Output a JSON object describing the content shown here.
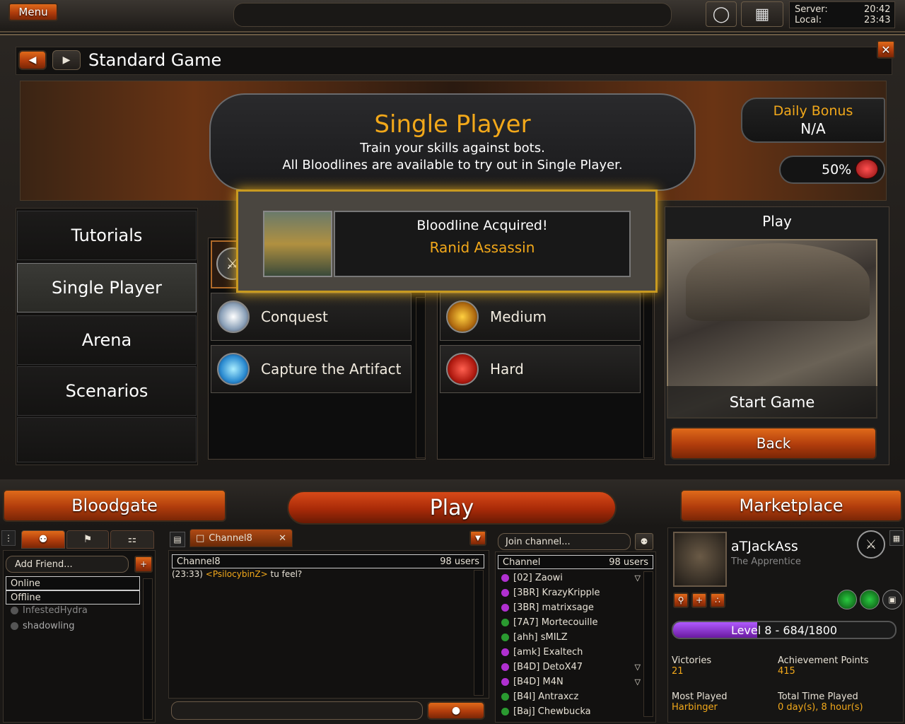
{
  "topbar": {
    "menu_label": "Menu",
    "server_label": "Server:",
    "server_time": "20:42",
    "local_label": "Local:",
    "local_time": "23:43"
  },
  "header": {
    "title": "Standard Game"
  },
  "banner": {
    "title": "Single Player",
    "line1": "Train your skills against bots.",
    "line2": "All Bloodlines are available to try out in Single Player."
  },
  "daily": {
    "label": "Daily Bonus",
    "value": "N/A",
    "percent": "50%"
  },
  "menu": {
    "items": [
      "Tutorials",
      "Single Player",
      "Arena",
      "Scenarios"
    ]
  },
  "notice": {
    "title": "Bloodline Acquired!",
    "name": "Ranid Assassin"
  },
  "modes": [
    "Conquest",
    "Capture the Artifact"
  ],
  "difficulty": [
    "Medium",
    "Hard"
  ],
  "playpanel": {
    "title": "Play",
    "start": "Start Game",
    "back": "Back"
  },
  "nav": {
    "left": "Bloodgate",
    "center": "Play",
    "right": "Marketplace"
  },
  "friends": {
    "add": "Add Friend...",
    "online": "Online",
    "offline": "Offline",
    "names": [
      "InfestedHydra",
      "shadowling"
    ]
  },
  "chat": {
    "tab": "Channel8",
    "header": "Channel8",
    "users": "98 users",
    "message_time": "(23:33)",
    "message_user": "<PsilocybinZ>",
    "message_text": "tu feel?"
  },
  "channel": {
    "join": "Join channel...",
    "header": "Channel",
    "users": "98 users",
    "members": [
      "[02] Zaowi",
      "[3BR] KrazyKripple",
      "[3BR] matrixsage",
      "[7A7] Mortecouille",
      "[ahh] sMILZ",
      "[amk] Exaltech",
      "[B4D] DetoX47",
      "[B4D] M4N",
      "[B4I] Antraxcz",
      "[Baj] Chewbucka"
    ]
  },
  "profile": {
    "name": "aTJackAss",
    "title": "The Apprentice",
    "level": "Level 8 - 684/1800",
    "level_fraction": 0.38,
    "stats": [
      {
        "label": "Victories",
        "value": "21"
      },
      {
        "label": "Achievement Points",
        "value": "415"
      },
      {
        "label": "Most Played",
        "value": "Harbinger"
      },
      {
        "label": "Total Time Played",
        "value": "0 day(s), 8 hour(s)"
      }
    ]
  },
  "colors": {
    "accent": "#f2a81a",
    "button": "#c0460e",
    "level_bar": "#8a2ad0"
  }
}
